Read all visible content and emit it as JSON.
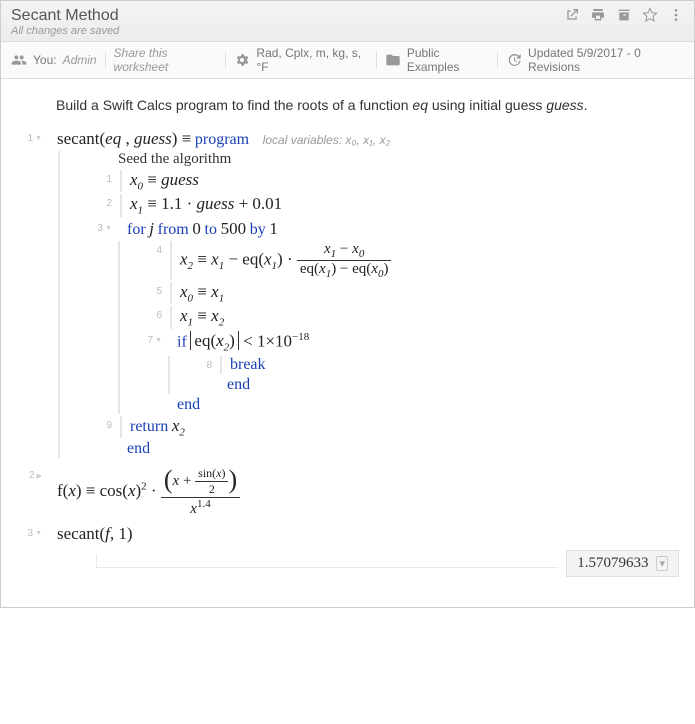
{
  "header": {
    "title": "Secant Method",
    "saved": "All changes are saved"
  },
  "toolbar": {
    "you": "You:",
    "admin": "Admin",
    "share": "Share this worksheet",
    "units": "Rad, Cplx, m, kg, s, °F",
    "pub": "Public Examples",
    "updated": "Updated 5/9/2017 - 0 Revisions"
  },
  "intro": {
    "t1": "Build a Swift Calcs program to find the roots of a function ",
    "eq": "eq",
    "t2": " using initial guess ",
    "guess": "guess",
    "t3": "."
  },
  "prog": {
    "def1": "secant",
    "def_eq": "eq",
    "def_guess": "guess",
    "kw_program": "program",
    "locals": "local variables: x₀, x₁, x₂",
    "seed": "Seed the algorithm",
    "x0g": "guess",
    "x1g": "guess",
    "for": "for",
    "from": "from",
    "to": "to",
    "by": "by",
    "j": "j",
    "f0": "0",
    "f500": "500",
    "f1": "1",
    "if": "if",
    "thresh": "1×10",
    "threshexp": "−18",
    "break": "break",
    "end": "end",
    "return": "return"
  },
  "gutters": {
    "g1": "1",
    "g2": "2",
    "g3": "3",
    "n1": "1",
    "n2": "2",
    "n3": "3",
    "n4": "4",
    "n5": "5",
    "n6": "6",
    "n7": "7",
    "n8": "8",
    "n9": "9"
  },
  "fdef": {
    "exp2": "2",
    "exp14": "1.4"
  },
  "call": {
    "arg": "1"
  },
  "result": "1.57079633"
}
